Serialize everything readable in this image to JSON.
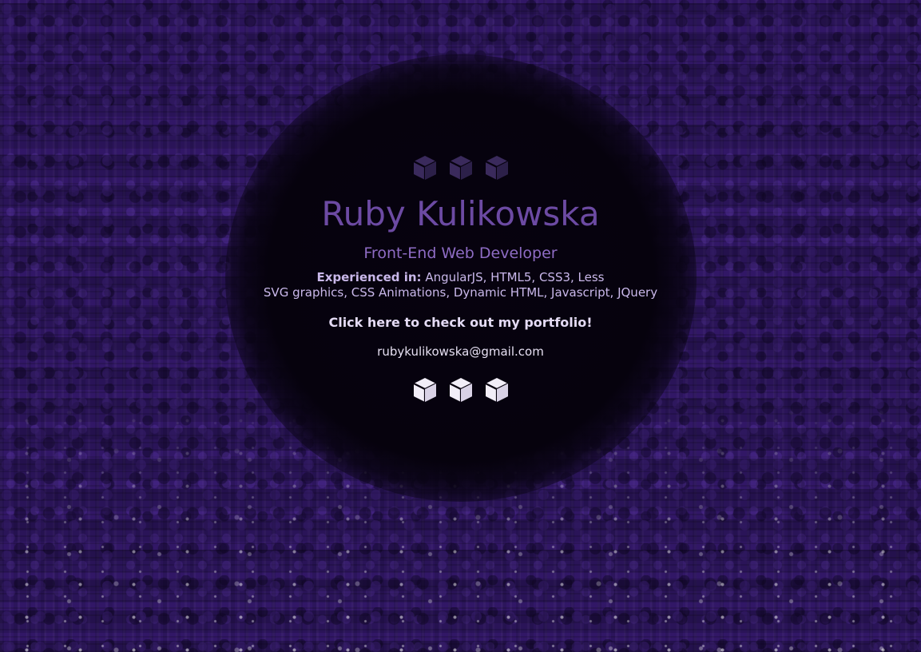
{
  "header": {
    "icons": [
      "cube-icon",
      "cube-icon",
      "cube-icon"
    ],
    "icon_color": "#3a2a5c"
  },
  "profile": {
    "name": "Ruby Kulikowska",
    "title": "Front-End Web Developer",
    "skills_label": "Experienced in:",
    "skills_line1": "AngularJS, HTML5, CSS3, Less",
    "skills_line2": "SVG graphics, CSS Animations, Dynamic HTML, Javascript, JQuery",
    "portfolio_link": "Click here to check out my portfolio!",
    "email": "rubykulikowska@gmail.com"
  },
  "footer": {
    "icons": [
      "cube-icon",
      "cube-icon",
      "cube-icon"
    ],
    "icon_color": "#f2eef8"
  },
  "colors": {
    "background": "#3b1d72",
    "name": "#6c4aa3",
    "subtitle": "#8e6cc4",
    "text": "#c9b8ea"
  }
}
